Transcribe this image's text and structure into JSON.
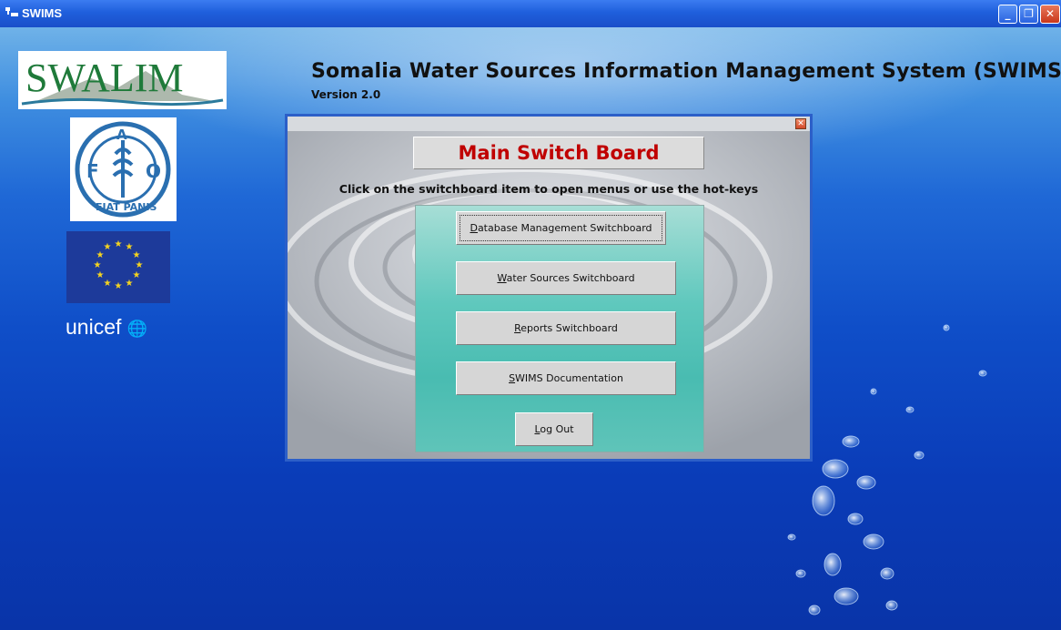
{
  "window": {
    "title": "SWIMS",
    "controls": [
      "minimize-icon",
      "restore-icon",
      "close-icon"
    ]
  },
  "header": {
    "title": "Somalia Water Sources Information Management System (SWIMS)",
    "version": "Version 2.0"
  },
  "logos": {
    "swalim": "SWALIM",
    "fao_letters": [
      "F",
      "A",
      "O"
    ],
    "fao_motto": "FIAT PANIS",
    "unicef": "unicef"
  },
  "switchboard": {
    "title": "Main Switch Board",
    "instructions": "Click on the switchboard item to open menus or use the hot-keys",
    "buttons": [
      {
        "hotkey": "D",
        "rest": "atabase Management Switchboard"
      },
      {
        "hotkey": "W",
        "rest": "ater Sources Switchboard"
      },
      {
        "hotkey": "R",
        "rest": "eports Switchboard"
      },
      {
        "hotkey": "S",
        "rest": "WIMS Documentation"
      },
      {
        "hotkey": "L",
        "rest": "og Out"
      }
    ]
  },
  "colors": {
    "titlebar": "#1f5fdc",
    "switchboard_title": "#c00000",
    "panel_teal": "#49bcb1",
    "water_deep": "#0a3cb8"
  }
}
